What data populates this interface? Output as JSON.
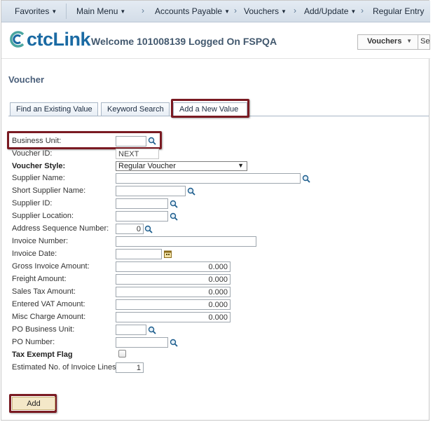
{
  "nav": {
    "favorites": "Favorites",
    "main_menu": "Main Menu",
    "accounts_payable": "Accounts Payable",
    "vouchers": "Vouchers",
    "add_update": "Add/Update",
    "regular_entry": "Regular Entry",
    "separator": "›"
  },
  "header": {
    "logo_text": "ctcLink",
    "welcome": "Welcome 101008139 Logged On FSPQA",
    "search_select": "Vouchers",
    "search_rest": "Se"
  },
  "page": {
    "title": "Voucher",
    "tabs": {
      "find_existing": "Find an Existing Value",
      "keyword_search": "Keyword Search",
      "add_new": "Add a New Value"
    }
  },
  "form": {
    "business_unit": {
      "label": "Business Unit:",
      "value": ""
    },
    "voucher_id": {
      "label": "Voucher ID:",
      "value": "NEXT"
    },
    "voucher_style": {
      "label": "Voucher Style:",
      "value": "Regular Voucher"
    },
    "supplier_name": {
      "label": "Supplier Name:",
      "value": ""
    },
    "short_supplier_name": {
      "label": "Short Supplier Name:",
      "value": ""
    },
    "supplier_id": {
      "label": "Supplier ID:",
      "value": ""
    },
    "supplier_location": {
      "label": "Supplier Location:",
      "value": ""
    },
    "address_sequence": {
      "label": "Address Sequence Number:",
      "value": "0"
    },
    "invoice_number": {
      "label": "Invoice Number:",
      "value": ""
    },
    "invoice_date": {
      "label": "Invoice Date:",
      "value": ""
    },
    "gross_invoice_amount": {
      "label": "Gross Invoice Amount:",
      "value": "0.000"
    },
    "freight_amount": {
      "label": "Freight Amount:",
      "value": "0.000"
    },
    "sales_tax_amount": {
      "label": "Sales Tax Amount:",
      "value": "0.000"
    },
    "entered_vat_amount": {
      "label": "Entered VAT Amount:",
      "value": "0.000"
    },
    "misc_charge_amount": {
      "label": "Misc Charge Amount:",
      "value": "0.000"
    },
    "po_business_unit": {
      "label": "PO Business Unit:",
      "value": ""
    },
    "po_number": {
      "label": "PO Number:",
      "value": ""
    },
    "tax_exempt_flag": {
      "label": "Tax Exempt Flag",
      "checked": false
    },
    "estimated_invoice_lines": {
      "label": "Estimated No. of Invoice Lines:",
      "value": "1"
    }
  },
  "actions": {
    "add_label": "Add"
  },
  "colors": {
    "highlight": "#7a1a22",
    "accent": "#1a6aa3",
    "add_button": "#f4e8c8"
  },
  "icons": {
    "lookup": "magnifier-icon",
    "calendar": "calendar-icon",
    "dropdown": "chevron-down-icon"
  }
}
